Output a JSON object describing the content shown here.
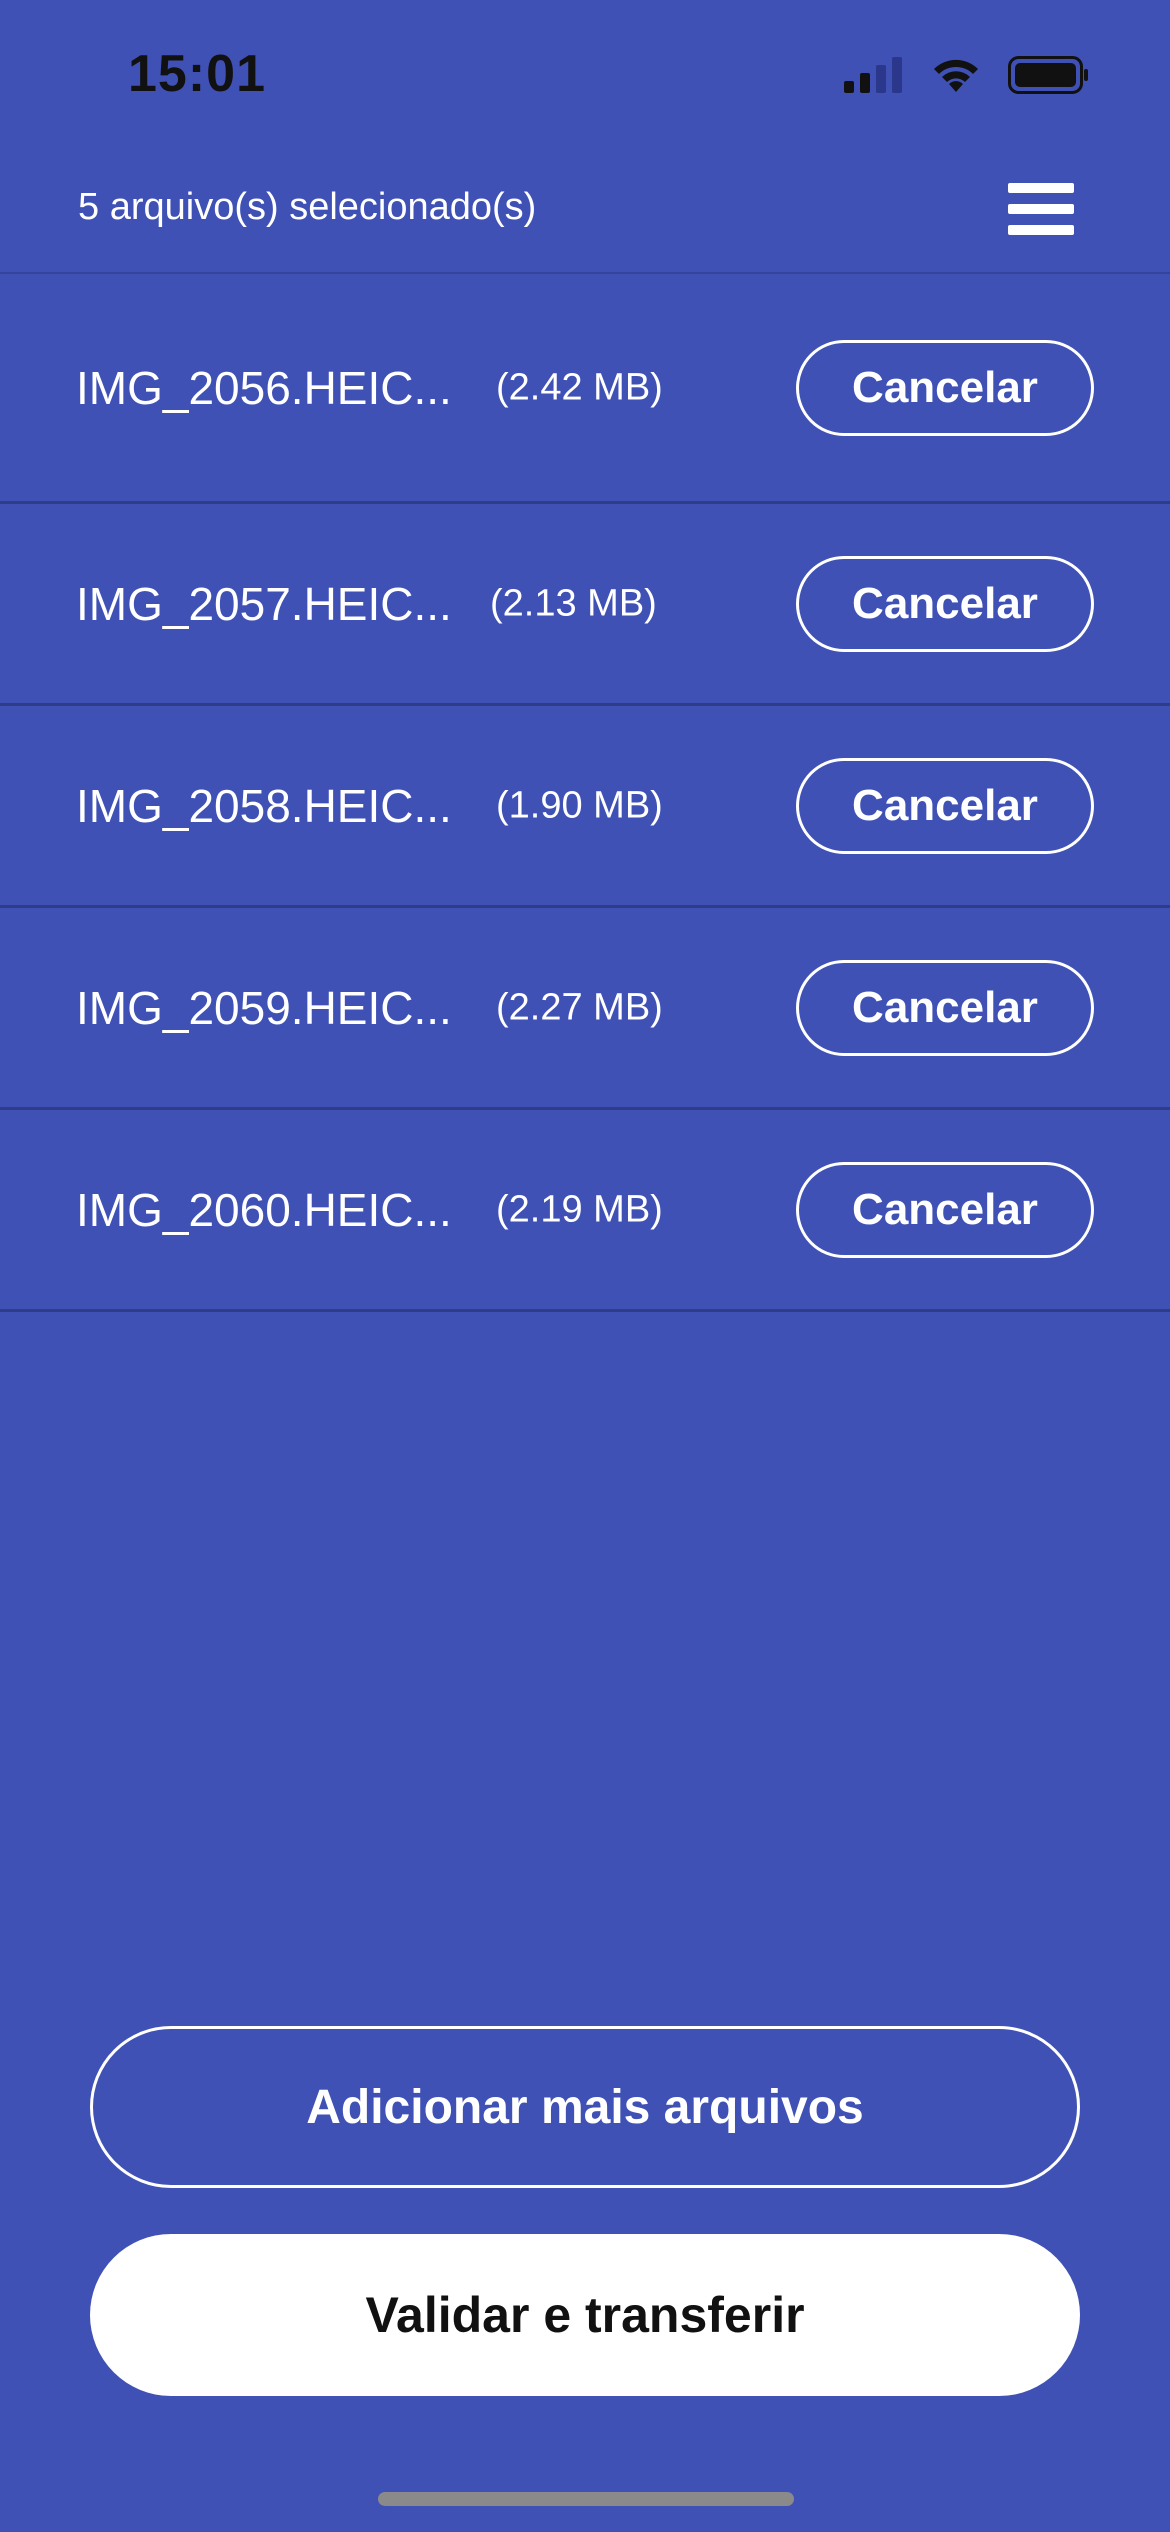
{
  "status_bar": {
    "time": "15:01",
    "icons": [
      "cellular-signal-icon",
      "wifi-icon",
      "battery-icon"
    ]
  },
  "header": {
    "title": "5 arquivo(s) selecionado(s)",
    "menu_icon": "hamburger-menu-icon"
  },
  "files": [
    {
      "name": "IMG_2056.HEIC...",
      "size": "(2.42 MB)",
      "cancel_label": "Cancelar"
    },
    {
      "name": "IMG_2057.HEIC...",
      "size": "(2.13 MB)",
      "cancel_label": "Cancelar"
    },
    {
      "name": "IMG_2058.HEIC...",
      "size": "(1.90 MB)",
      "cancel_label": "Cancelar"
    },
    {
      "name": "IMG_2059.HEIC...",
      "size": "(2.27 MB)",
      "cancel_label": "Cancelar"
    },
    {
      "name": "IMG_2060.HEIC...",
      "size": "(2.19 MB)",
      "cancel_label": "Cancelar"
    }
  ],
  "actions": {
    "add_more_label": "Adicionar mais arquivos",
    "validate_label": "Validar e transferir"
  },
  "colors": {
    "background": "#3f51b5",
    "divider": "#2f3d88",
    "text": "#ffffff",
    "primary_button_bg": "#ffffff",
    "primary_button_text": "#111111"
  }
}
